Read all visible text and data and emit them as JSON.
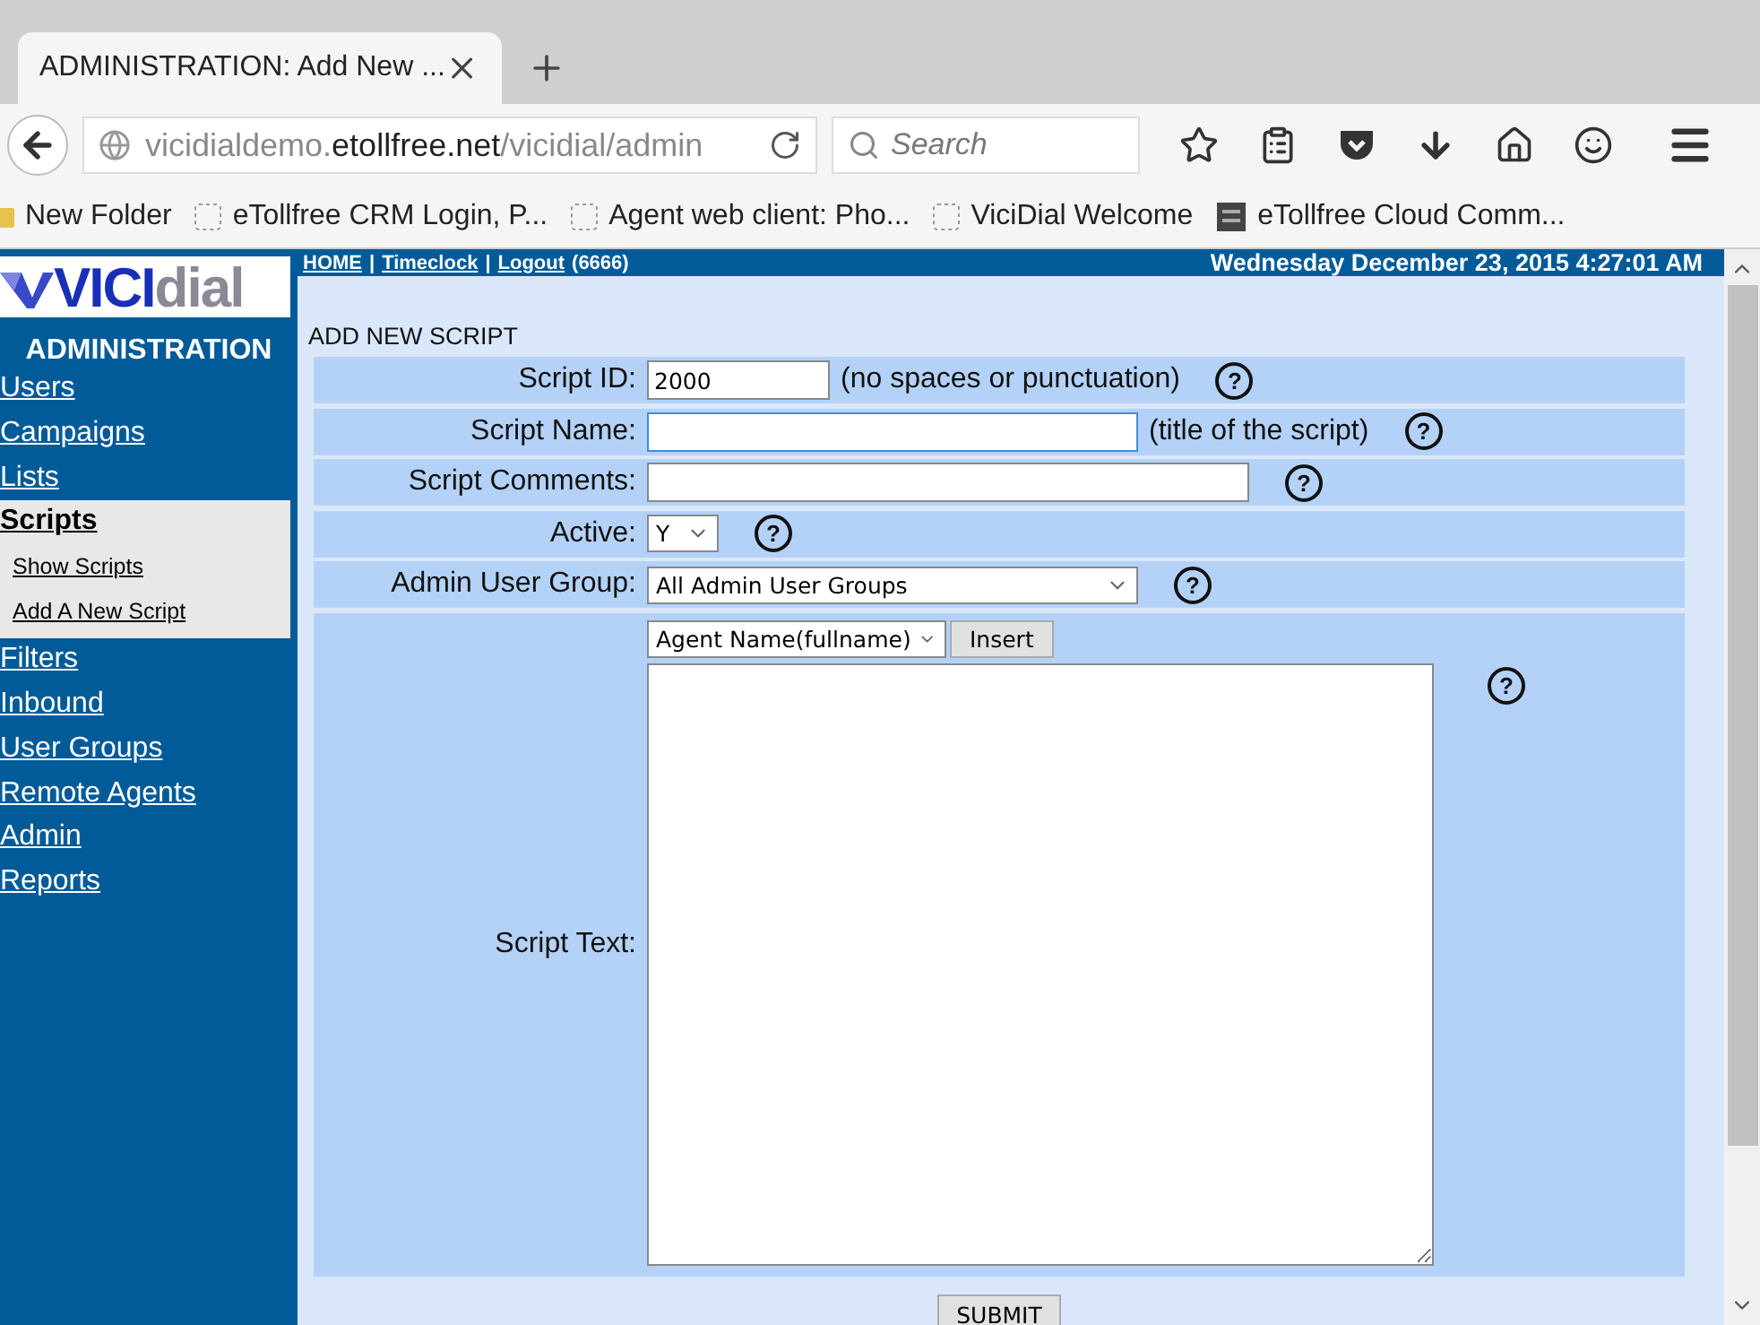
{
  "browser": {
    "tab": {
      "title": "ADMINISTRATION: Add New ...",
      "selected": true
    },
    "url": {
      "prefix": "vicidialdemo.",
      "domain": "etollfree.net",
      "path": "/vicidial/admin"
    },
    "search": {
      "placeholder": "Search"
    },
    "bookmarks": [
      {
        "kind": "folder",
        "label": "New Folder"
      },
      {
        "kind": "page",
        "label": "eTollfree CRM Login, P..."
      },
      {
        "kind": "page",
        "label": "Agent web client: Pho..."
      },
      {
        "kind": "page",
        "label": "ViciDial Welcome"
      },
      {
        "kind": "app",
        "label": "eTollfree Cloud Comm..."
      }
    ]
  },
  "sidebar": {
    "logo": {
      "part_1": "VICI",
      "part_2": "dial"
    },
    "title": "ADMINISTRATION",
    "items": [
      {
        "label": "Users",
        "selected": false
      },
      {
        "label": "Campaigns",
        "selected": false
      },
      {
        "label": "Lists",
        "selected": false
      },
      {
        "label": "Scripts",
        "selected": true,
        "children": [
          {
            "label": "Show Scripts"
          },
          {
            "label": "Add A New Script"
          }
        ]
      },
      {
        "label": "Filters",
        "selected": false
      },
      {
        "label": "Inbound",
        "selected": false
      },
      {
        "label": "User Groups",
        "selected": false
      },
      {
        "label": "Remote Agents",
        "selected": false
      },
      {
        "label": "Admin",
        "selected": false
      },
      {
        "label": "Reports",
        "selected": false
      }
    ]
  },
  "header": {
    "links": [
      {
        "kind": "link",
        "text": "HOME"
      },
      {
        "kind": "sep",
        "text": "|"
      },
      {
        "kind": "link",
        "text": "Timeclock"
      },
      {
        "kind": "sep",
        "text": "|"
      },
      {
        "kind": "link",
        "text": "Logout"
      },
      {
        "kind": "note",
        "text": "(6666)"
      }
    ],
    "datetime": "Wednesday December 23, 2015 4:27:01 AM"
  },
  "form": {
    "title": "ADD NEW SCRIPT",
    "rows": [
      {
        "kind": "text",
        "label": "Script ID:",
        "value": "2000",
        "focused": false,
        "hint": "(no spaces or punctuation)",
        "help": "?"
      },
      {
        "kind": "text",
        "label": "Script Name:",
        "value": "",
        "focused": true,
        "hint": "(title of the script)",
        "help": "?"
      },
      {
        "kind": "text",
        "label": "Script Comments:",
        "value": "",
        "focused": false,
        "help": "?"
      },
      {
        "kind": "select",
        "label": "Active:",
        "value": "Y",
        "help": "?"
      },
      {
        "kind": "select",
        "label": "Admin User Group:",
        "value": "All Admin User Groups",
        "help": "?"
      },
      {
        "kind": "textarea",
        "label": "Script Text:",
        "insert_select": "Agent Name(fullname)",
        "insert_button": "Insert",
        "help": "?"
      }
    ],
    "submit": "SUBMIT"
  }
}
